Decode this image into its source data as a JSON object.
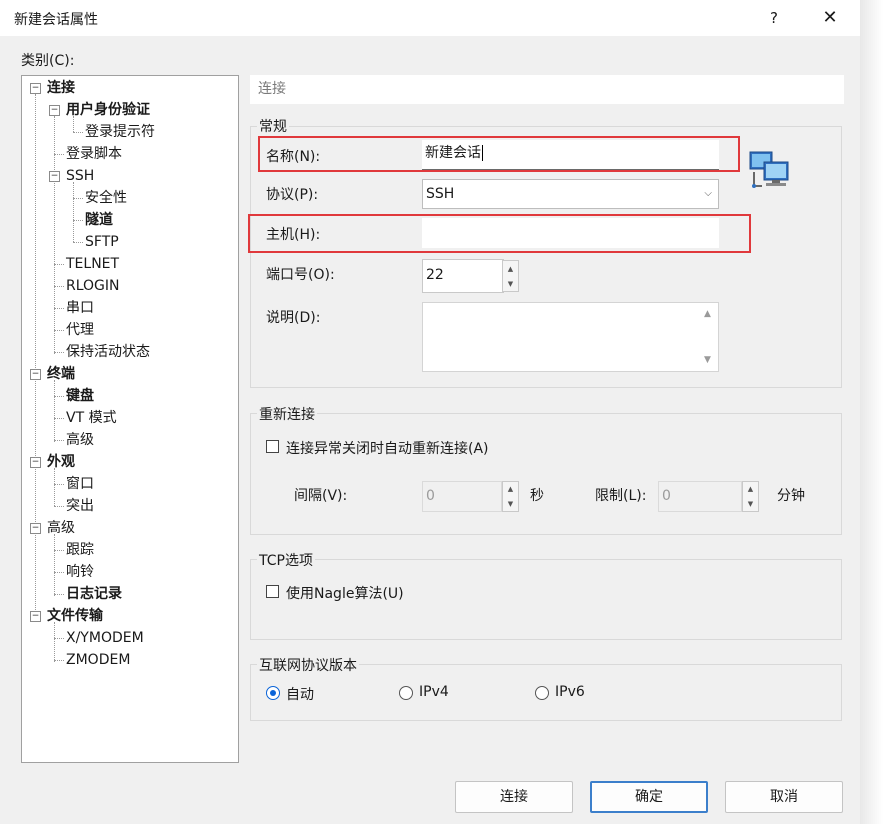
{
  "window": {
    "title": "新建会话属性",
    "help": "?",
    "close": "✕"
  },
  "category": {
    "label": "类别(C):",
    "items": [
      {
        "label": "连接",
        "bold": true
      },
      {
        "label": "用户身份验证",
        "bold": true
      },
      {
        "label": "登录提示符",
        "bold": false
      },
      {
        "label": "登录脚本",
        "bold": false
      },
      {
        "label": "SSH",
        "bold": false
      },
      {
        "label": "安全性",
        "bold": false
      },
      {
        "label": "隧道",
        "bold": true
      },
      {
        "label": "SFTP",
        "bold": false
      },
      {
        "label": "TELNET",
        "bold": false
      },
      {
        "label": "RLOGIN",
        "bold": false
      },
      {
        "label": "串口",
        "bold": false
      },
      {
        "label": "代理",
        "bold": false
      },
      {
        "label": "保持活动状态",
        "bold": false
      },
      {
        "label": "终端",
        "bold": true
      },
      {
        "label": "键盘",
        "bold": true
      },
      {
        "label": "VT 模式",
        "bold": false
      },
      {
        "label": "高级",
        "bold": false
      },
      {
        "label": "外观",
        "bold": true
      },
      {
        "label": "窗口",
        "bold": false
      },
      {
        "label": "突出",
        "bold": false
      },
      {
        "label": "高级",
        "bold": false
      },
      {
        "label": "跟踪",
        "bold": false
      },
      {
        "label": "响铃",
        "bold": false
      },
      {
        "label": "日志记录",
        "bold": true
      },
      {
        "label": "文件传输",
        "bold": true
      },
      {
        "label": "X/YMODEM",
        "bold": false
      },
      {
        "label": "ZMODEM",
        "bold": false
      }
    ]
  },
  "breadcrumb": "连接",
  "general": {
    "title": "常规",
    "name_label": "名称(N):",
    "name_value": "新建会话",
    "protocol_label": "协议(P):",
    "protocol_value": "SSH",
    "host_label": "主机(H):",
    "host_value": "",
    "port_label": "端口号(O):",
    "port_value": "22",
    "desc_label": "说明(D):",
    "desc_value": ""
  },
  "reconnect": {
    "title": "重新连接",
    "checkbox_label": "连接异常关闭时自动重新连接(A)",
    "interval_label": "间隔(V):",
    "interval_value": "0",
    "seconds_label": "秒",
    "limit_label": "限制(L):",
    "limit_value": "0",
    "minutes_label": "分钟"
  },
  "tcp": {
    "title": "TCP选项",
    "nagle_label": "使用Nagle算法(U)"
  },
  "ip": {
    "title": "互联网协议版本",
    "options": [
      "自动",
      "IPv4",
      "IPv6"
    ],
    "selected": "自动"
  },
  "buttons": {
    "connect": "连接",
    "ok": "确定",
    "cancel": "取消"
  },
  "colors": {
    "highlight_box": "#e0393c",
    "accent": "#0a64d8"
  }
}
